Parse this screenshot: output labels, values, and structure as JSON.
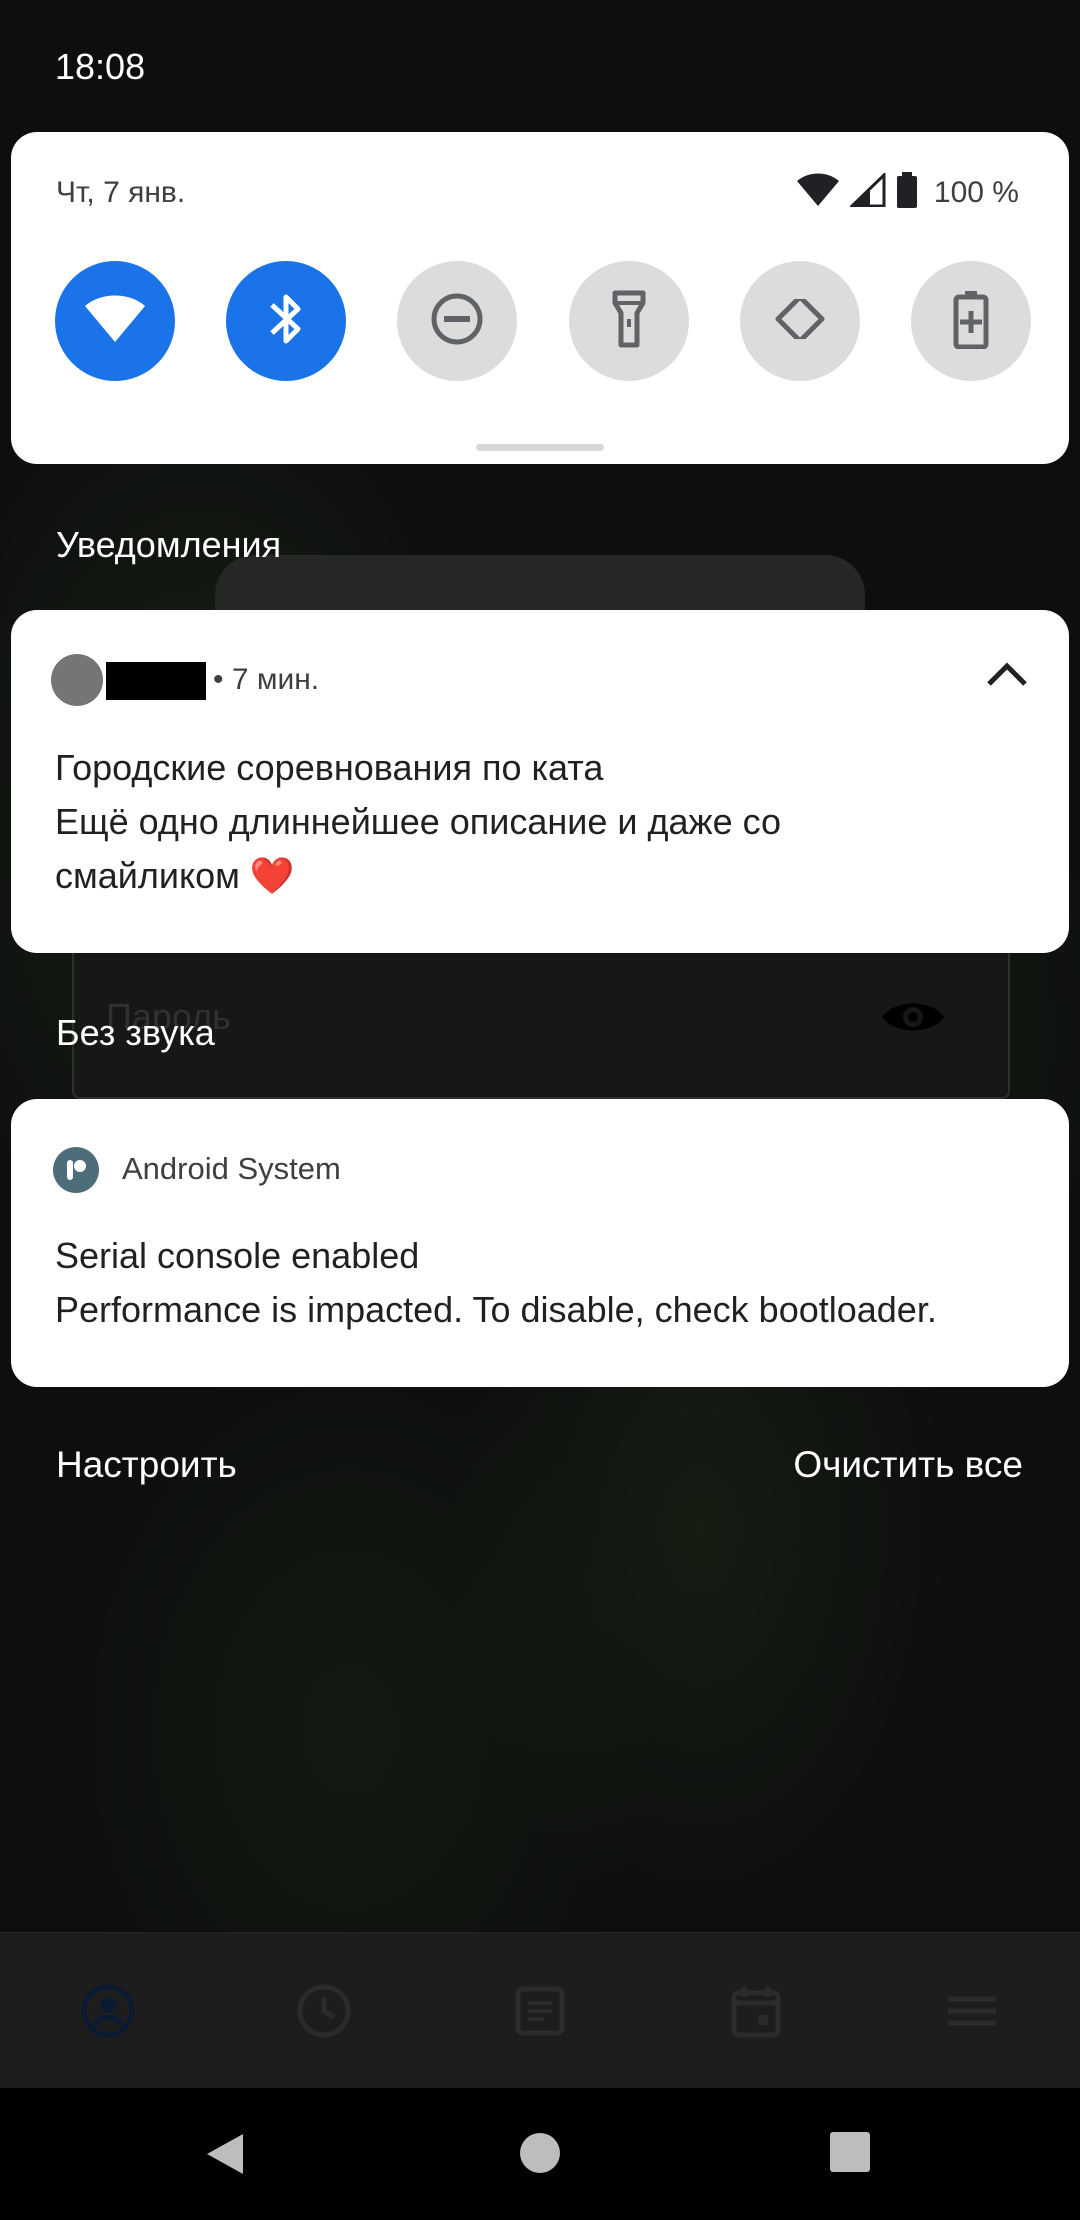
{
  "status_bar": {
    "time": "18:08"
  },
  "quick_settings": {
    "date": "Чт, 7 янв.",
    "battery_text": "100 %",
    "tiles": [
      {
        "name": "wifi",
        "state": "on"
      },
      {
        "name": "bluetooth",
        "state": "on"
      },
      {
        "name": "do-not-disturb",
        "state": "off"
      },
      {
        "name": "flashlight",
        "state": "off"
      },
      {
        "name": "auto-rotate",
        "state": "off"
      },
      {
        "name": "battery-saver",
        "state": "off"
      }
    ]
  },
  "sections": {
    "notifications": "Уведомления",
    "silent": "Без звука"
  },
  "notification_1": {
    "time": "• 7 мин.",
    "title": "Городские соревнования по ката",
    "text": "Ещё одно длиннейшее описание и даже со смайликом ❤️"
  },
  "notification_2": {
    "app": "Android System",
    "title": "Serial console enabled",
    "text": "Performance is impacted. To disable, check bootloader."
  },
  "actions": {
    "manage": "Настроить",
    "clear_all": "Очистить все"
  },
  "background_app": {
    "password_label": "Пароль"
  },
  "colors": {
    "accent": "#1a73e8",
    "tile_off": "#dcdcdc"
  }
}
